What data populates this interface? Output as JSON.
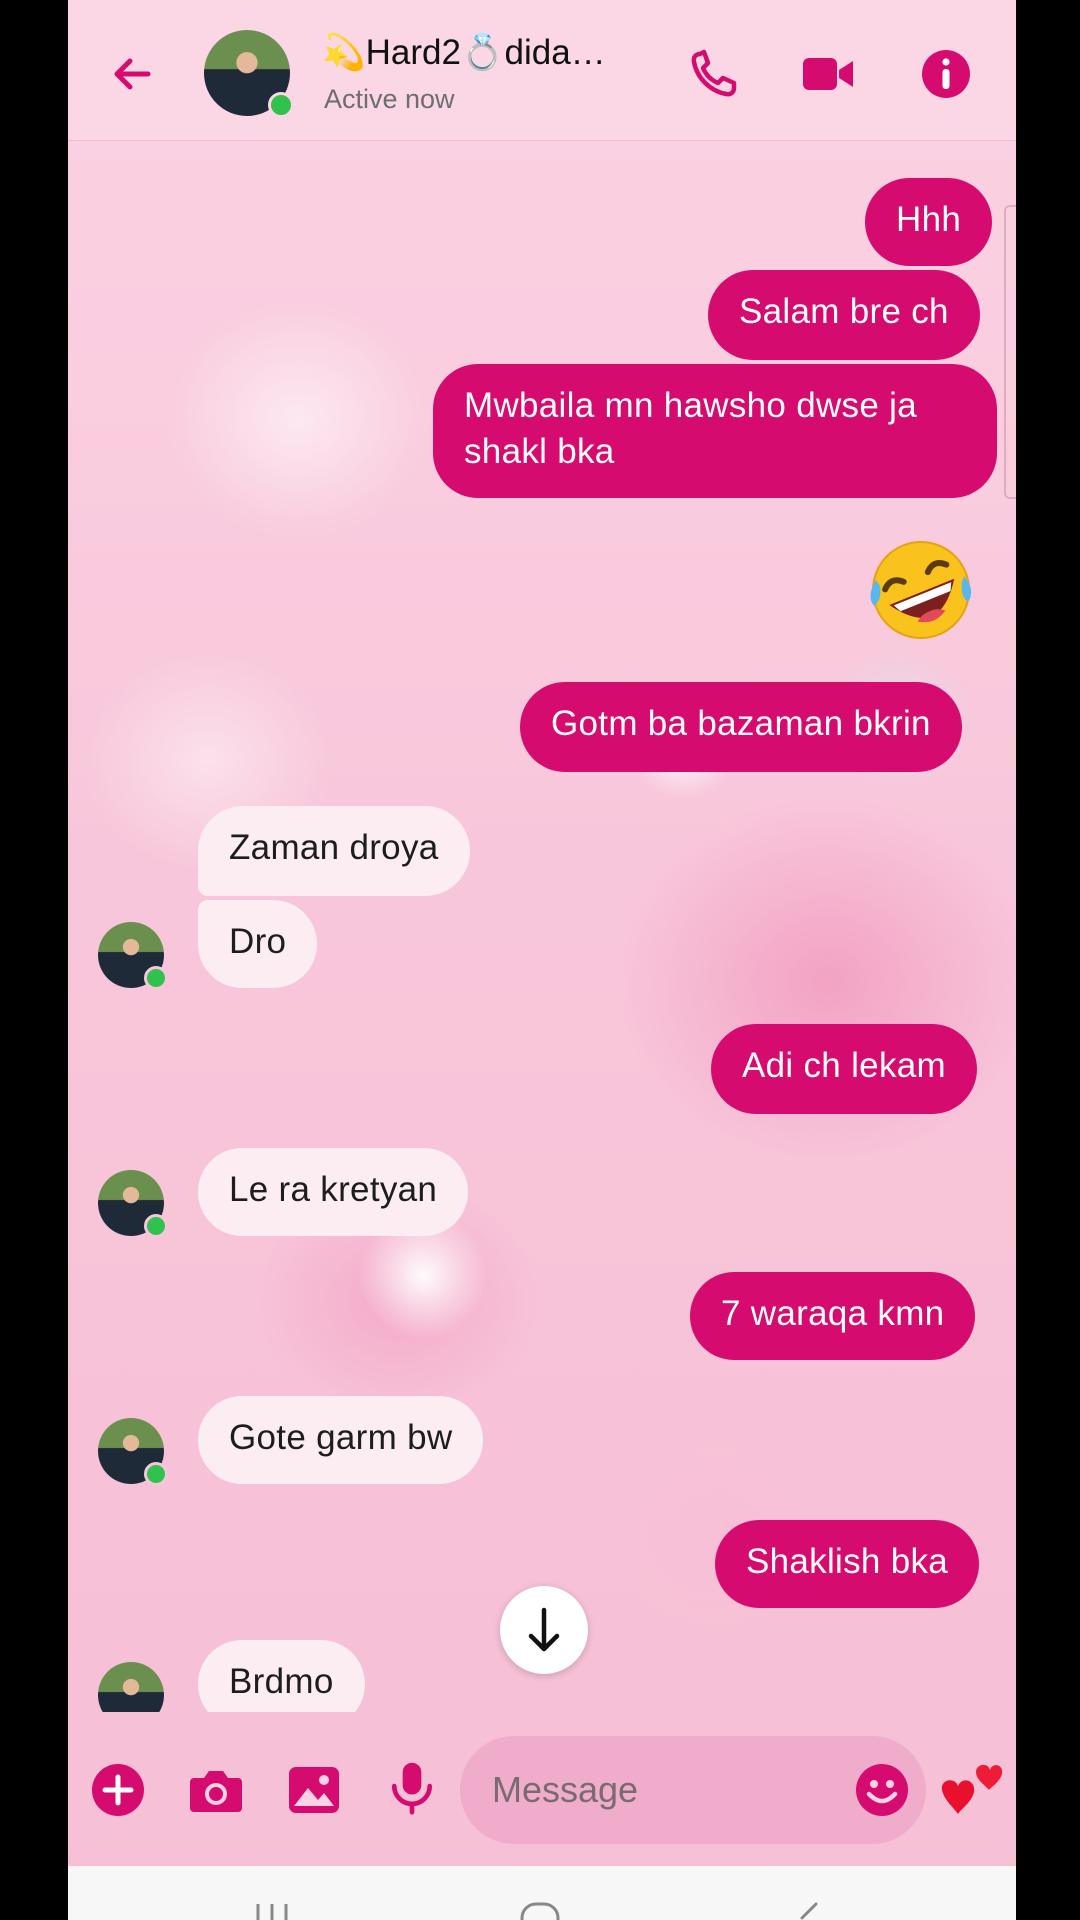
{
  "header": {
    "contact_name": "💫Hard2💍dida…",
    "status": "Active now"
  },
  "messages": [
    {
      "side": "out",
      "text": "Hhh"
    },
    {
      "side": "out",
      "text": "Salam bre ch"
    },
    {
      "side": "out",
      "text": "Mwbaila mn hawsho dwse ja shakl bka"
    },
    {
      "side": "out",
      "emoji": "rolling-on-floor-laughing"
    },
    {
      "side": "out",
      "text": "Gotm ba bazaman bkrin"
    },
    {
      "side": "in",
      "text": "Zaman droya"
    },
    {
      "side": "in",
      "text": "Dro"
    },
    {
      "side": "out",
      "text": "Adi ch lekam"
    },
    {
      "side": "in",
      "text": "Le ra kretyan"
    },
    {
      "side": "out",
      "text": "7 waraqa kmn"
    },
    {
      "side": "in",
      "text": "Gote garm bw"
    },
    {
      "side": "out",
      "text": "Shaklish bka"
    },
    {
      "side": "in",
      "text": "Brdmo"
    }
  ],
  "composer": {
    "placeholder": "Message"
  },
  "colors": {
    "accent": "#d60b6f",
    "incoming_bubble": "#fcedf3",
    "header_bg": "#fbd7e6",
    "online": "#31c24d"
  },
  "icons": [
    "back-arrow-icon",
    "phone-icon",
    "video-camera-icon",
    "info-icon",
    "plus-icon",
    "camera-icon",
    "image-icon",
    "microphone-icon",
    "emoji-icon",
    "hearts-icon",
    "arrow-down-icon"
  ]
}
